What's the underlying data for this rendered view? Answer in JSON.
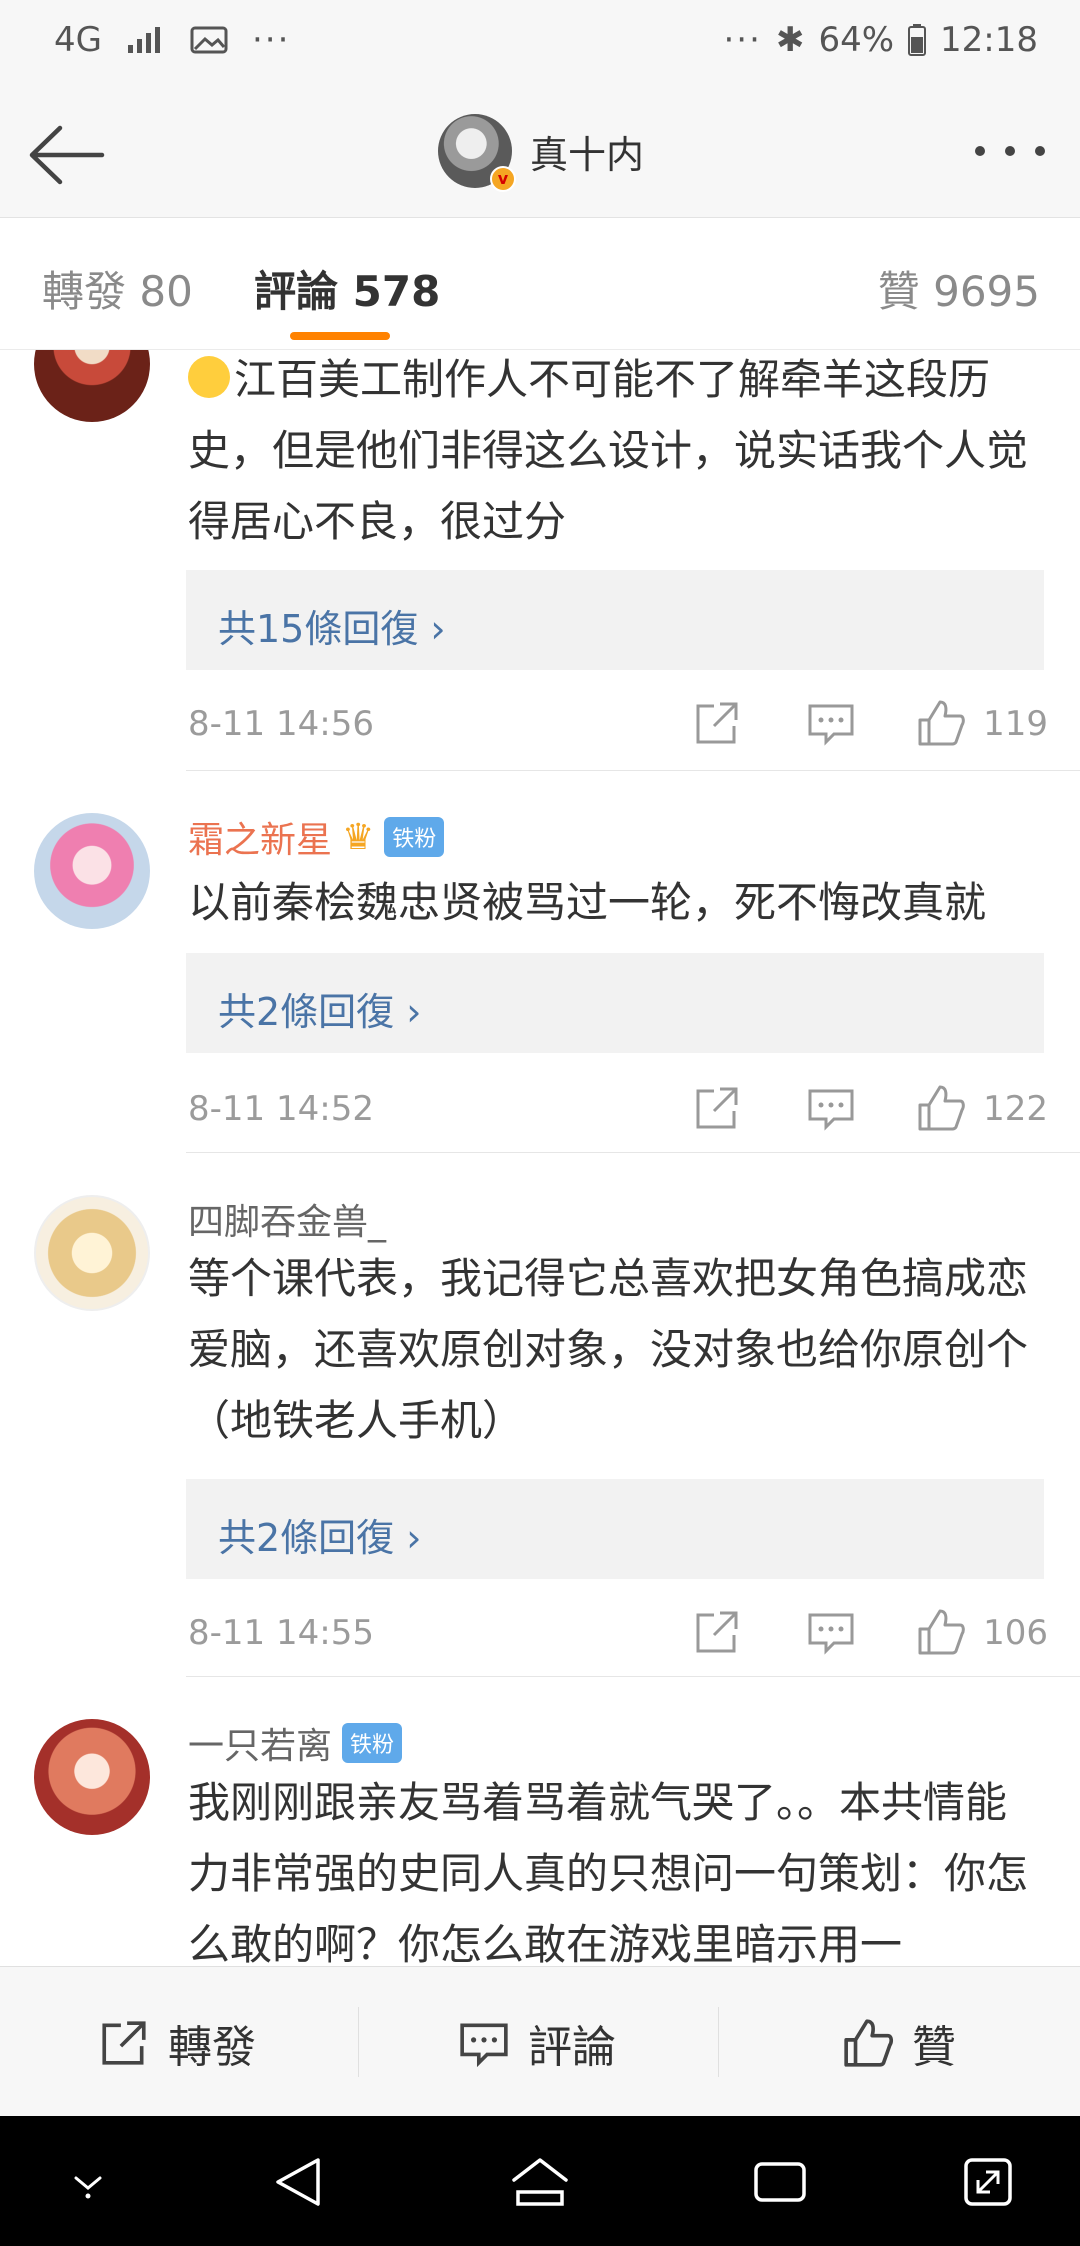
{
  "status": {
    "network": "4G",
    "battery": "64%",
    "time": "12:18",
    "dots": "···"
  },
  "nav": {
    "title": "真十内",
    "verified": "v"
  },
  "tabs": {
    "repost": "轉發 80",
    "comments": "評論 578",
    "likes": "贊 9695"
  },
  "comments": [
    {
      "user": "",
      "text": "江百美工制作人不可能不了解牵羊这段历史，但是他们非得这么设计，说实话我个人觉得居心不良，很过分",
      "replies": "共15條回復 ›",
      "time": "8-11 14:56",
      "likes": "119"
    },
    {
      "user": "霜之新星",
      "badge": "铁粉",
      "text": "以前秦桧魏忠贤被骂过一轮，死不悔改真就",
      "replies": "共2條回復 ›",
      "time": "8-11 14:52",
      "likes": "122"
    },
    {
      "user": "四脚吞金兽_",
      "text": "等个课代表，我记得它总喜欢把女角色搞成恋爱脑，还喜欢原创对象，没对象也给你原创个（地铁老人手机）",
      "replies": "共2條回復 ›",
      "time": "8-11 14:55",
      "likes": "106"
    },
    {
      "user": "一只若离",
      "badge": "铁粉",
      "text": "我刚刚跟亲友骂着骂着就气哭了。。本共情能力非常强的史同人真的只想问一句策划：你怎么敢的啊？你怎么敢在游戏里暗示用一"
    }
  ],
  "bottom": {
    "repost": "轉發",
    "comment": "評論",
    "like": "贊"
  }
}
